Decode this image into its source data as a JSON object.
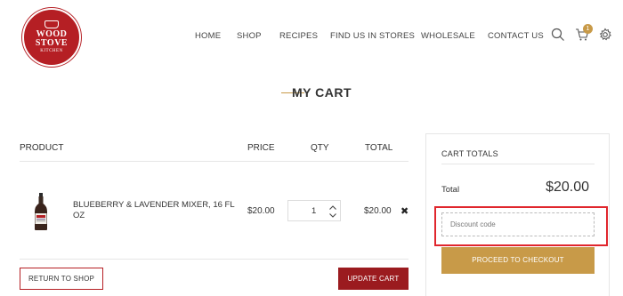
{
  "logo": {
    "line1": "WOOD",
    "line2": "STOVE",
    "line3": "KITCHEN"
  },
  "nav": {
    "items": [
      {
        "label": "HOME"
      },
      {
        "label": "SHOP"
      },
      {
        "label": "RECIPES"
      },
      {
        "label": "FIND US IN STORES"
      },
      {
        "label": "WHOLESALE"
      },
      {
        "label": "CONTACT US"
      }
    ],
    "icons": [
      "search-icon",
      "cart-icon",
      "gear-icon"
    ],
    "cart_count": "1"
  },
  "page": {
    "title": "MY CART"
  },
  "cart_table": {
    "headers": {
      "product": "PRODUCT",
      "price": "PRICE",
      "qty": "QTY",
      "total": "TOTAL"
    },
    "rows": [
      {
        "name": "BLUEBERRY & LAVENDER MIXER, 16 FL OZ",
        "price": "$20.00",
        "qty": "1",
        "total": "$20.00",
        "remove_icon": "close-icon"
      }
    ]
  },
  "buttons": {
    "return": "RETURN TO SHOP",
    "update": "UPDATE CART",
    "checkout": "PROCEED TO CHECKOUT"
  },
  "totals": {
    "title": "CART TOTALS",
    "total_label": "Total",
    "total_value": "$20.00",
    "discount_placeholder": "Discount code",
    "discount_value": ""
  },
  "colors": {
    "brand_red": "#b51f24",
    "update_button": "#9b1b1f",
    "gold_accent": "#c89a48",
    "focus_outline": "#e0262d"
  }
}
